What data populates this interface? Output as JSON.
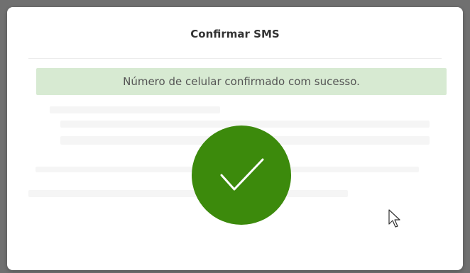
{
  "dialog": {
    "title": "Confirmar SMS",
    "success_message": "Número de celular confirmado com sucesso."
  },
  "icons": {
    "status": "checkmark-icon",
    "pointer": "mouse-cursor-icon"
  },
  "colors": {
    "success_circle": "#3c8a0c",
    "alert_background": "#d7ead2",
    "modal_background": "#ffffff",
    "backdrop": "#707070"
  }
}
